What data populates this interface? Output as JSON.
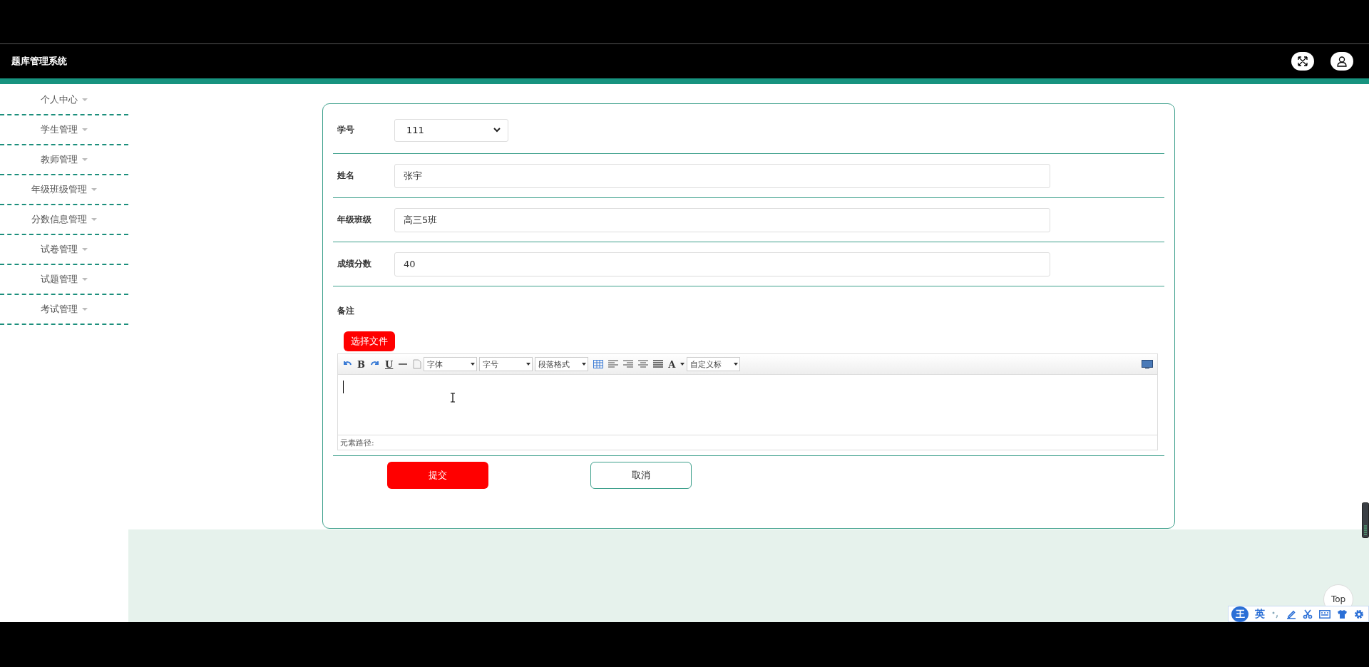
{
  "header": {
    "title": "题库管理系统"
  },
  "sidebar": {
    "items": [
      {
        "label": "个人中心"
      },
      {
        "label": "学生管理"
      },
      {
        "label": "教师管理"
      },
      {
        "label": "年级班级管理"
      },
      {
        "label": "分数信息管理"
      },
      {
        "label": "试卷管理"
      },
      {
        "label": "试题管理"
      },
      {
        "label": "考试管理"
      }
    ]
  },
  "form": {
    "fields": [
      {
        "label": "学号",
        "kind": "select",
        "value": "111"
      },
      {
        "label": "姓名",
        "kind": "input",
        "value": "张宇"
      },
      {
        "label": "年级班级",
        "kind": "input",
        "value": "高三5班"
      },
      {
        "label": "成绩分数",
        "kind": "input",
        "value": "40"
      }
    ],
    "remark": {
      "label": "备注",
      "upload_button": "选择文件",
      "editor": {
        "bold": "B",
        "underline": "U",
        "font_color": "A",
        "font_family": "字体",
        "font_size": "字号",
        "paragraph": "段落格式",
        "custom_title": "自定义标",
        "element_path": "元素路径:"
      }
    },
    "buttons": {
      "submit": "提交",
      "cancel": "取消"
    }
  },
  "back_to_top": "Top",
  "ime_bar": {
    "logo": "王",
    "mode": "英"
  }
}
